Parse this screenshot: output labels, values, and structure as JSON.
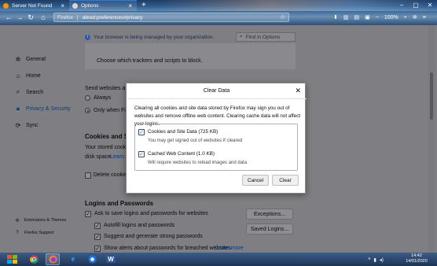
{
  "tabs": [
    {
      "title": "Server Not Found"
    },
    {
      "title": "Options"
    }
  ],
  "new_tab_label": "+",
  "window_controls": {
    "minimize": "−",
    "maximize": "▢",
    "close": "✕"
  },
  "nav": {
    "url_brand": "Firefox",
    "url": "about:preferences#privacy",
    "zoom": "100%"
  },
  "policy_notice": "Your browser is being managed by your organization.",
  "find_placeholder": "Find in Options",
  "sidebar": {
    "items": [
      {
        "label": "General",
        "icon": "gear-icon"
      },
      {
        "label": "Home",
        "icon": "home-icon"
      },
      {
        "label": "Search",
        "icon": "search-icon"
      },
      {
        "label": "Privacy & Security",
        "icon": "lock-icon"
      },
      {
        "label": "Sync",
        "icon": "sync-icon"
      }
    ],
    "footer": [
      {
        "label": "Extensions & Themes",
        "icon": "puzzle-icon"
      },
      {
        "label": "Firefox Support",
        "icon": "help-icon"
      }
    ]
  },
  "page": {
    "tracker_text": "Choose which trackers and scripts to block.",
    "dnt_label": "Send websites a \"Do",
    "dnt_always": "Always",
    "dnt_only": "Only when Firef",
    "cookies_heading": "Cookies and Site",
    "cookies_text1": "Your stored cookies,",
    "cookies_text2": "disk space.",
    "cookies_learn": "Learn m",
    "delete_cookies": "Delete cookies a",
    "logins_heading": "Logins and Passwords",
    "ask_save": "Ask to save logins and passwords for websites",
    "autofill": "Autofill logins and passwords",
    "suggest": "Suggest and generate strong passwords",
    "alerts": "Show alerts about passwords for breached websites",
    "alerts_learn": "Learn more",
    "exceptions_btn": "Exceptions...",
    "saved_logins_btn": "Saved Logins..."
  },
  "dialog": {
    "title": "Clear Data",
    "description": "Clearing all cookies and site data stored by Firefox may sign you out of websites and remove offline web content. Clearing cache data will not affect your logins.",
    "options": [
      {
        "label": "Cookies and Site Data (725 KB)",
        "sub": "You may get signed out of websites if cleared",
        "checked": true
      },
      {
        "label": "Cached Web Content (1.0 KB)",
        "sub": "Will require websites to reload images and data",
        "checked": true
      }
    ],
    "cancel": "Cancel",
    "clear": "Clear"
  },
  "taskbar": {
    "time": "14:42",
    "date": "14/01/2020"
  },
  "colors": {
    "accent": "#0a84ff",
    "taskbar": "#1e3556"
  }
}
